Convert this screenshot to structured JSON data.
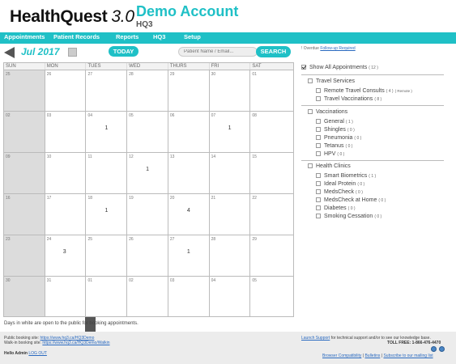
{
  "header": {
    "logo_main": "HealthQuest",
    "logo_version": "3.0",
    "account_title": "Demo Account",
    "account_code": "HQ3"
  },
  "nav": {
    "items": [
      "Appointments",
      "Patient Records",
      "Reports",
      "HQ3",
      "Setup"
    ]
  },
  "toolbar": {
    "month": "Jul 2017",
    "today_label": "TODAY",
    "search_placeholder": "Patient Name / Email...",
    "search_label": "SEARCH"
  },
  "calendar": {
    "weekdays": [
      "SUN",
      "MON",
      "TUES",
      "WED",
      "THURS",
      "FRI",
      "SAT"
    ],
    "weeks": [
      [
        {
          "day": "25",
          "count": ""
        },
        {
          "day": "26",
          "count": ""
        },
        {
          "day": "27",
          "count": ""
        },
        {
          "day": "28",
          "count": ""
        },
        {
          "day": "29",
          "count": ""
        },
        {
          "day": "30",
          "count": ""
        },
        {
          "day": "01",
          "count": ""
        }
      ],
      [
        {
          "day": "02",
          "count": ""
        },
        {
          "day": "03",
          "count": ""
        },
        {
          "day": "04",
          "count": "1"
        },
        {
          "day": "05",
          "count": ""
        },
        {
          "day": "06",
          "count": ""
        },
        {
          "day": "07",
          "count": "1"
        },
        {
          "day": "08",
          "count": ""
        }
      ],
      [
        {
          "day": "09",
          "count": ""
        },
        {
          "day": "10",
          "count": ""
        },
        {
          "day": "11",
          "count": ""
        },
        {
          "day": "12",
          "count": "1"
        },
        {
          "day": "13",
          "count": ""
        },
        {
          "day": "14",
          "count": ""
        },
        {
          "day": "15",
          "count": ""
        }
      ],
      [
        {
          "day": "16",
          "count": ""
        },
        {
          "day": "17",
          "count": ""
        },
        {
          "day": "18",
          "count": "1"
        },
        {
          "day": "19",
          "count": ""
        },
        {
          "day": "20",
          "count": "4"
        },
        {
          "day": "21",
          "count": ""
        },
        {
          "day": "22",
          "count": ""
        }
      ],
      [
        {
          "day": "23",
          "count": ""
        },
        {
          "day": "24",
          "count": "3"
        },
        {
          "day": "25",
          "count": ""
        },
        {
          "day": "26",
          "count": ""
        },
        {
          "day": "27",
          "count": "1"
        },
        {
          "day": "28",
          "count": ""
        },
        {
          "day": "29",
          "count": ""
        }
      ],
      [
        {
          "day": "30",
          "count": ""
        },
        {
          "day": "31",
          "count": ""
        },
        {
          "day": "01",
          "count": ""
        },
        {
          "day": "02",
          "count": ""
        },
        {
          "day": "03",
          "count": ""
        },
        {
          "day": "04",
          "count": ""
        },
        {
          "day": "05",
          "count": ""
        }
      ]
    ],
    "note": "Days in white are open to the public for booking appointments."
  },
  "panel": {
    "overdue_prefix": "! Overdue",
    "overdue_link": "Follow-up Required",
    "show_all": {
      "label": "Show All Appointments",
      "count": "( 12 )"
    },
    "travel": {
      "title": "Travel Services",
      "items": [
        {
          "label": "Remote Travel Consults",
          "count": "( 4 )",
          "extra": "( Remote )"
        },
        {
          "label": "Travel Vaccinations",
          "count": "( 8 )"
        }
      ]
    },
    "vaccinations": {
      "title": "Vaccinations",
      "items": [
        {
          "label": "General",
          "count": "( 1 )"
        },
        {
          "label": "Shingles",
          "count": "( 0 )"
        },
        {
          "label": "Pneumonia",
          "count": "( 0 )"
        },
        {
          "label": "Tetanus",
          "count": "( 0 )"
        },
        {
          "label": "HPV",
          "count": "( 0 )"
        }
      ]
    },
    "clinics": {
      "title": "Health Clinics",
      "items": [
        {
          "label": "Smart Biometrics",
          "count": "( 1 )"
        },
        {
          "label": "Ideal Protein",
          "count": "( 0 )"
        },
        {
          "label": "MedsCheck",
          "count": "( 0 )"
        },
        {
          "label": "MedsCheck at Home",
          "count": "( 0 )"
        },
        {
          "label": "Diabetes",
          "count": "( 0 )"
        },
        {
          "label": "Smoking Cessation",
          "count": "( 0 )"
        }
      ]
    }
  },
  "footer": {
    "public_label": "Public booking site:",
    "public_url": "https://www.hq3.ca/HQ3Demo",
    "walkin_label": "Walk-in booking site:",
    "walkin_url": "https://www.hq3.ca/HQ3Demo/Walkin",
    "hello": "Hello Admin",
    "logout": "LOG OUT",
    "support_link": "Launch Support",
    "support_text": "for technical support and/or to see our knowledge base.",
    "tollfree": "TOLL FREE: 1-866-476-4470",
    "compat": "Browser Compatibility",
    "sep1": "|",
    "bulletins": "Bulletins",
    "sep2": "|",
    "subscribe": "Subscribe to our mailing list"
  }
}
